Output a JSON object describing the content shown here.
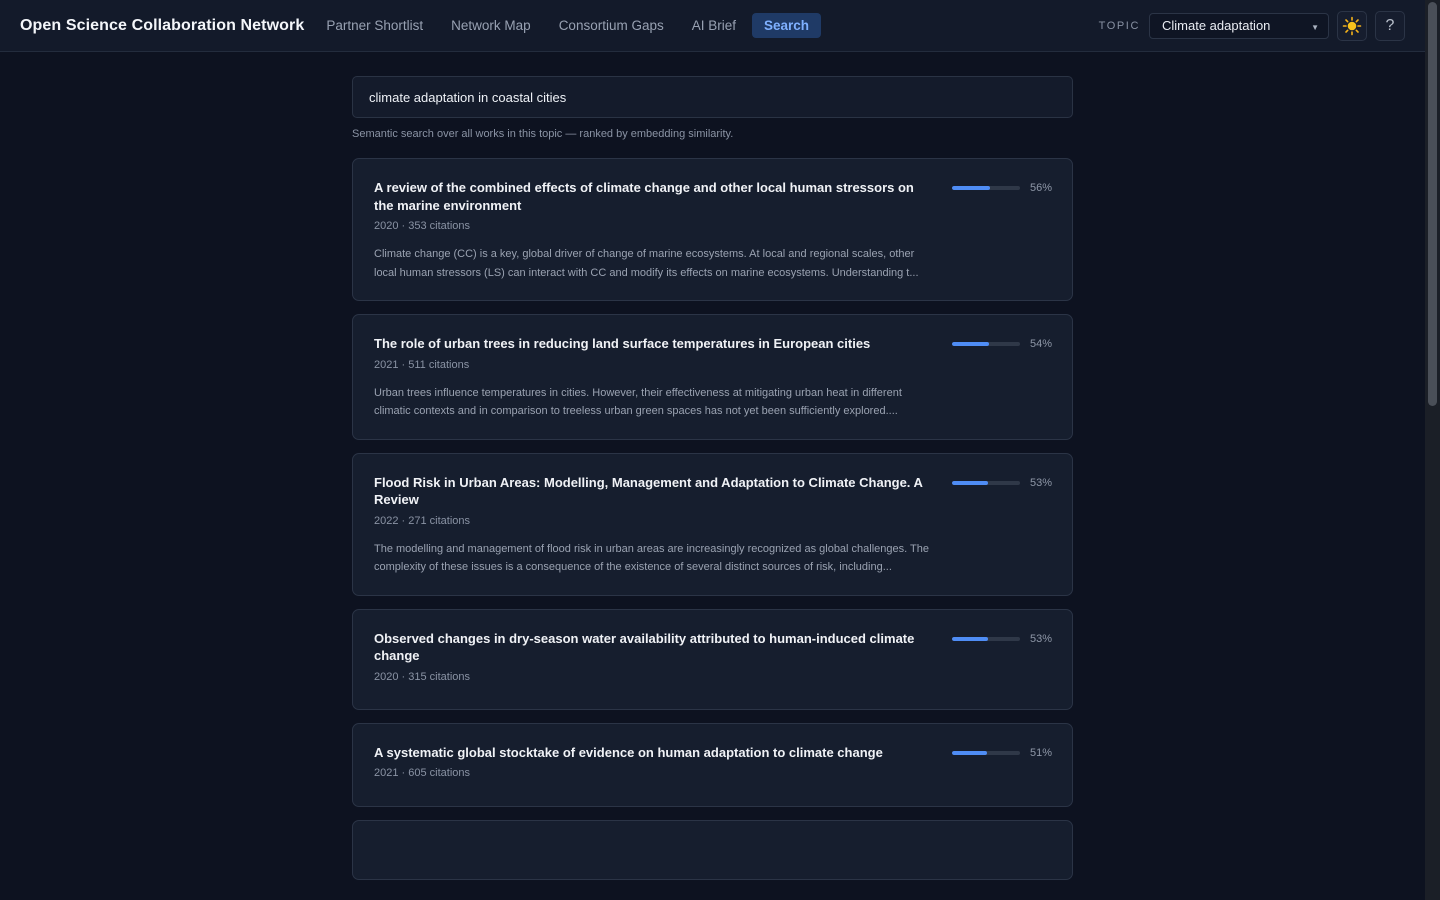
{
  "header": {
    "brand": "Open Science Collaboration Network",
    "nav": [
      {
        "label": "Partner Shortlist",
        "active": false
      },
      {
        "label": "Network Map",
        "active": false
      },
      {
        "label": "Consortium Gaps",
        "active": false
      },
      {
        "label": "AI Brief",
        "active": false
      },
      {
        "label": "Search",
        "active": true
      }
    ],
    "topic_label": "TOPIC",
    "topic_value": "Climate adaptation",
    "theme_icon": "sun-icon",
    "help_label": "?"
  },
  "search": {
    "query": "climate adaptation in coastal cities",
    "hint": "Semantic search over all works in this topic — ranked by embedding similarity."
  },
  "results": [
    {
      "title": "A review of the combined effects of climate change and other local human stressors on the marine environment",
      "meta": "2020 · 353 citations",
      "abstract": "Climate change (CC) is a key, global driver of change of marine ecosystems. At local and regional scales, other local human stressors (LS) can interact with CC and modify its effects on marine ecosystems. Understanding t...",
      "score": 56,
      "score_label": "56%"
    },
    {
      "title": "The role of urban trees in reducing land surface temperatures in European cities",
      "meta": "2021 · 511 citations",
      "abstract": "Urban trees influence temperatures in cities. However, their effectiveness at mitigating urban heat in different climatic contexts and in comparison to treeless urban green spaces has not yet been sufficiently explored....",
      "score": 54,
      "score_label": "54%"
    },
    {
      "title": "Flood Risk in Urban Areas: Modelling, Management and Adaptation to Climate Change. A Review",
      "meta": "2022 · 271 citations",
      "abstract": "The modelling and management of flood risk in urban areas are increasingly recognized as global challenges. The complexity of these issues is a consequence of the existence of several distinct sources of risk, including...",
      "score": 53,
      "score_label": "53%"
    },
    {
      "title": "Observed changes in dry-season water availability attributed to human-induced climate change",
      "meta": "2020 · 315 citations",
      "abstract": "",
      "score": 53,
      "score_label": "53%"
    },
    {
      "title": "A systematic global stocktake of evidence on human adaptation to climate change",
      "meta": "2021 · 605 citations",
      "abstract": "",
      "score": 51,
      "score_label": "51%"
    },
    {
      "title": "",
      "meta": "",
      "abstract": "",
      "score": null,
      "score_label": ""
    }
  ]
}
